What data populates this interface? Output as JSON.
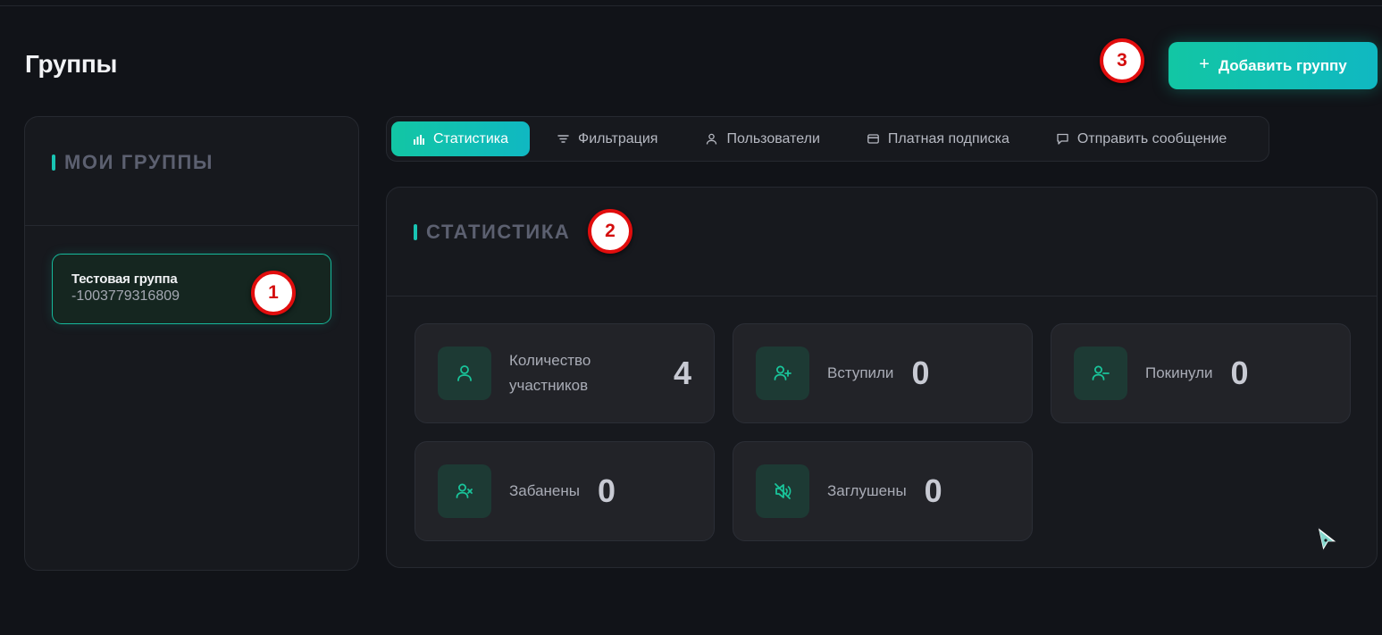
{
  "page": {
    "title": "Группы"
  },
  "header": {
    "add_group_label": "Добавить группу",
    "add_group_icon": "plus-icon"
  },
  "sidebar": {
    "title": "МОИ ГРУППЫ",
    "groups": [
      {
        "name": "Тестовая группа",
        "id": "-1003779316809"
      }
    ]
  },
  "tabs": [
    {
      "label": "Статистика",
      "icon": "bar-chart-icon",
      "active": true
    },
    {
      "label": "Фильтрация",
      "icon": "filter-icon",
      "active": false
    },
    {
      "label": "Пользователи",
      "icon": "user-icon",
      "active": false
    },
    {
      "label": "Платная подписка",
      "icon": "credit-card-icon",
      "active": false
    },
    {
      "label": "Отправить сообщение",
      "icon": "message-icon",
      "active": false
    }
  ],
  "stats": {
    "title": "СТАТИСТИКА",
    "items": [
      {
        "label": "Количество участников",
        "value": "4",
        "icon": "user-icon"
      },
      {
        "label": "Вступили",
        "value": "0",
        "icon": "user-plus-icon"
      },
      {
        "label": "Покинули",
        "value": "0",
        "icon": "user-minus-icon"
      },
      {
        "label": "Забанены",
        "value": "0",
        "icon": "user-x-icon"
      },
      {
        "label": "Заглушены",
        "value": "0",
        "icon": "volume-mute-icon"
      }
    ]
  },
  "annotations": [
    "1",
    "2",
    "3"
  ],
  "colors": {
    "accent": "#12c6a4",
    "accent_2": "#10b8c2",
    "marker": "#e10d0d",
    "background": "#111318"
  }
}
